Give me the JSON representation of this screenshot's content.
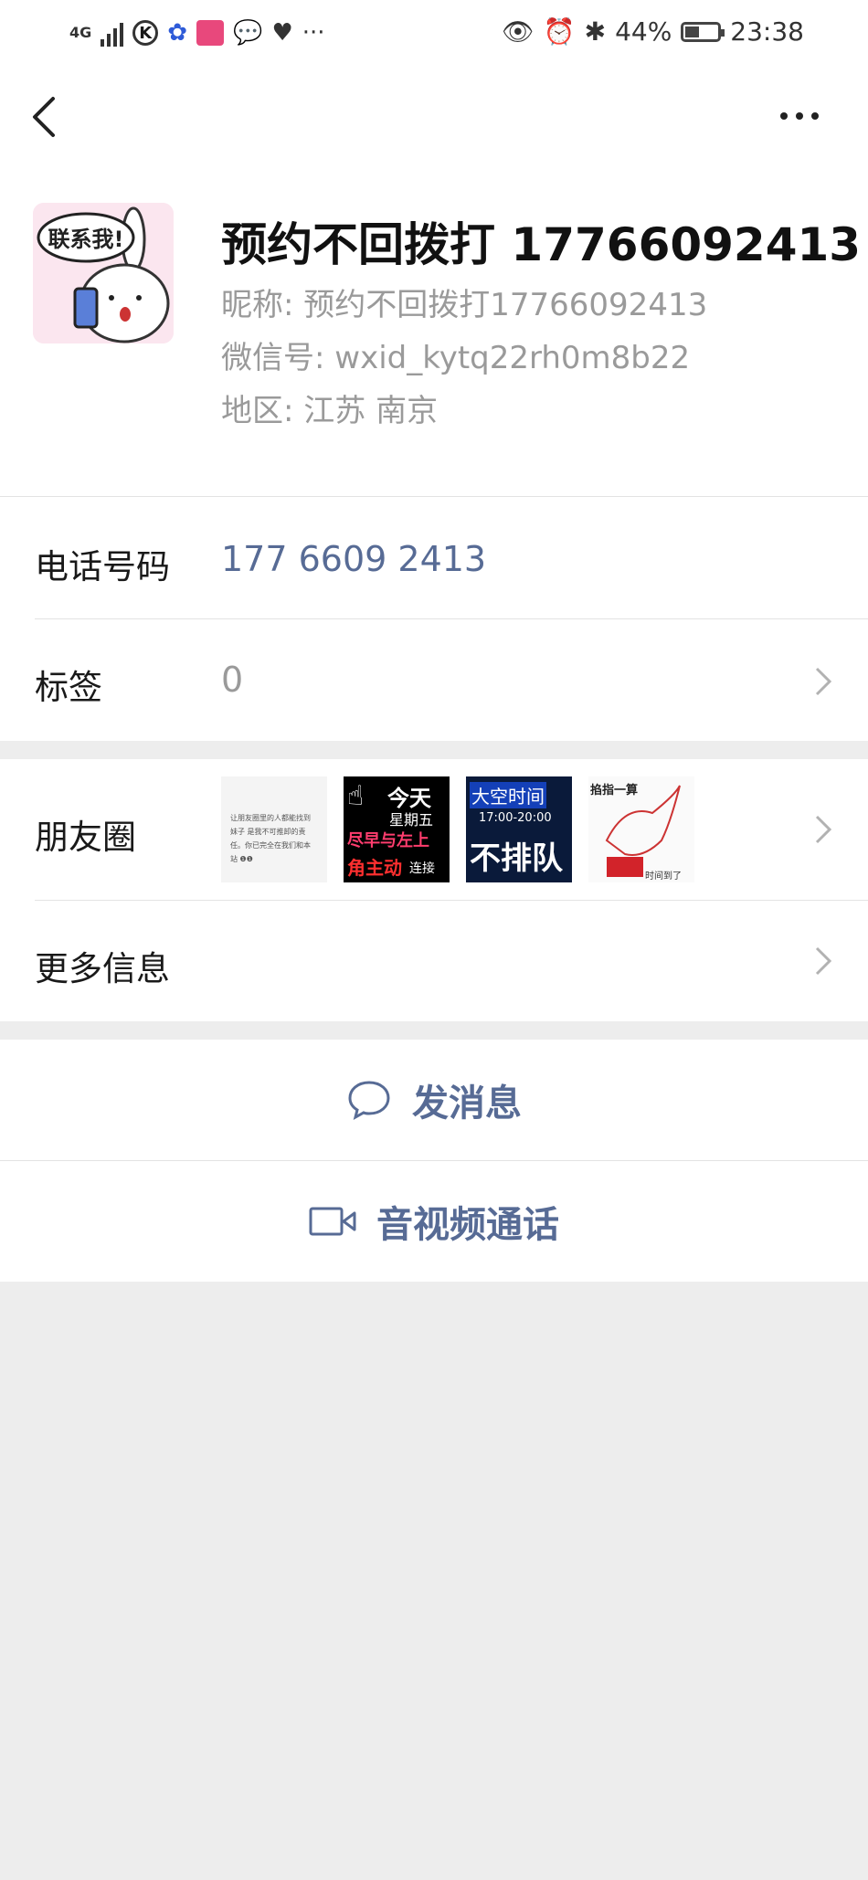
{
  "status_bar": {
    "network": "4G",
    "k_icon": "K",
    "battery_percent": "44%",
    "battery_level": 0.44,
    "time": "23:38",
    "more": "···"
  },
  "profile": {
    "display_name": "预约不回拨打 17766092413",
    "nickname_line": "昵称:  预约不回拨打17766092413",
    "wechat_id_line": "微信号:  wxid_kytq22rh0m8b22",
    "region_line": "地区:  江苏  南京",
    "avatar_text": "联系我!"
  },
  "phone": {
    "label": "电话号码",
    "value": "177 6609 2413"
  },
  "tags": {
    "label": "标签",
    "value": "0"
  },
  "moments": {
    "label": "朋友圈",
    "thumbs": [
      {
        "lines": [
          "让朋友圈里的人都能找到",
          "妹子 是我不可推卸的责",
          "任。你已完全在我们和本",
          "站 ❶❶"
        ]
      },
      {
        "lines": [
          "今天",
          "星期五",
          "尽早与左上",
          "角主动",
          "连接"
        ]
      },
      {
        "lines": [
          "大空时间",
          "17:00-20:00",
          "不排队"
        ]
      },
      {
        "lines": [
          "掐指一算",
          "时间到了"
        ]
      }
    ]
  },
  "more_info": {
    "label": "更多信息"
  },
  "actions": {
    "message": "发消息",
    "video_call": "音视频通话"
  },
  "colors": {
    "link": "#576b95",
    "background": "#ededed"
  }
}
